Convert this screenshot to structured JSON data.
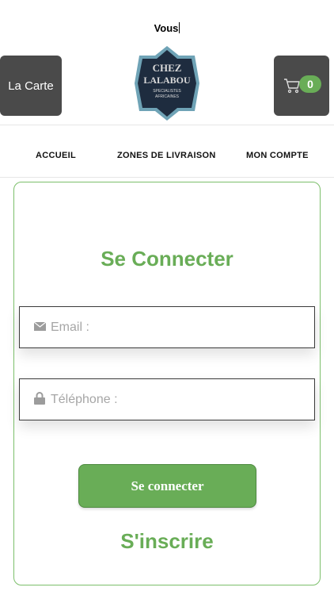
{
  "typing_text": "Vous",
  "header": {
    "menu_button_label": "La Carte",
    "logo_text": {
      "line1": "CHEZ",
      "line2": "LALABOU",
      "line3": "SPECIALISTES",
      "line4": "AFRICAINES"
    },
    "cart_count": "0"
  },
  "nav": {
    "items": [
      {
        "label": "ACCUEIL"
      },
      {
        "label": "ZONES DE LIVRAISON"
      },
      {
        "label": "MON COMPTE"
      }
    ]
  },
  "login": {
    "title": "Se Connecter",
    "email_placeholder": "Email :",
    "phone_placeholder": "Téléphone :",
    "submit_label": "Se connecter",
    "signup_label": "S'inscrire"
  },
  "colors": {
    "accent": "#69ad57",
    "dark_button": "#4a4a4a",
    "logo_navy": "#1e2c3f",
    "logo_teal": "#6fa3b6"
  }
}
